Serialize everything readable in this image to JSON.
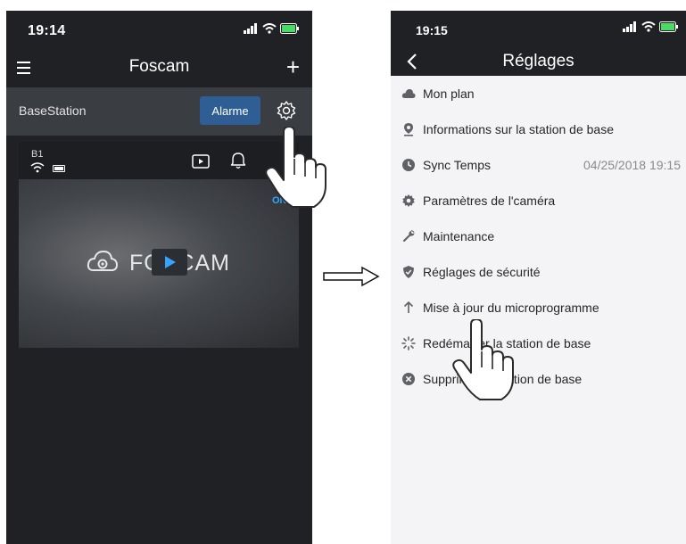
{
  "left_screen": {
    "status_time": "19:14",
    "app_title": "Foscam",
    "basestation_name": "BaseStation",
    "alarm_button": "Alarme",
    "camera": {
      "id": "B1",
      "on_label": "ON",
      "logo_text": "FOSCAM"
    }
  },
  "right_screen": {
    "status_time": "19:15",
    "title": "Réglages",
    "items": [
      {
        "label": "Mon plan",
        "icon": "cloud-icon"
      },
      {
        "label": "Informations sur la station de base",
        "icon": "location-pin-icon"
      },
      {
        "label": "Sync Temps",
        "icon": "clock-icon",
        "value": "04/25/2018 19:15"
      },
      {
        "label": "Paramètres de l'caméra",
        "icon": "gear-icon"
      },
      {
        "label": "Maintenance",
        "icon": "wrench-icon"
      },
      {
        "label": "Réglages de sécurité",
        "icon": "shield-icon"
      },
      {
        "label": "Mise à jour du microprogramme",
        "icon": "arrow-up-icon"
      },
      {
        "label": "Redémarrer la station de base",
        "icon": "spinner-icon"
      },
      {
        "label": "Supprimer la station de base",
        "icon": "close-circle-icon"
      }
    ]
  },
  "colors": {
    "dark_background": "#1f2125",
    "bar_background": "#3a3d42",
    "alarm_button": "#2f5e95",
    "accent_blue": "#38a3ff",
    "list_background": "#f4f4f6",
    "icon_gray": "#5f6166"
  }
}
